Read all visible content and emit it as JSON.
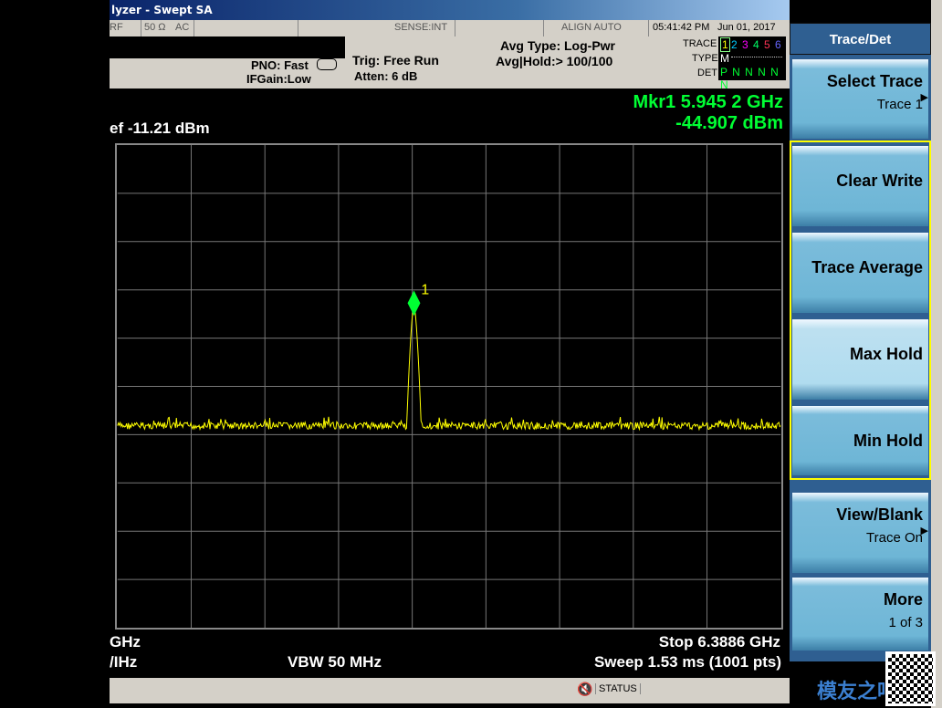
{
  "window": {
    "title": "lyzer - Swept SA"
  },
  "status": {
    "rf": "RF",
    "impedance": "50 Ω",
    "coupling": "AC",
    "sense": "SENSE:INT",
    "align": "ALIGN AUTO",
    "time": "05:41:42 PM",
    "date": "Jun 01, 2017"
  },
  "settings": {
    "pno": "PNO: Fast",
    "ifgain": "IFGain:Low",
    "trig": "Trig: Free Run",
    "atten": "Atten: 6 dB",
    "avg_type": "Avg Type: Log-Pwr",
    "avg_hold": "Avg|Hold:> 100/100"
  },
  "trace_table": {
    "trace_label": "TRACE",
    "type_label": "TYPE",
    "det_label": "DET",
    "traces": [
      "1",
      "2",
      "3",
      "4",
      "5",
      "6"
    ],
    "trace_colors": [
      "#ffff00",
      "#00ccff",
      "#ff00ff",
      "#00ff66",
      "#ff3355",
      "#6666ff"
    ],
    "type": "M",
    "det": "P N N N N N"
  },
  "ref_level": "ef -11.21 dBm",
  "marker": {
    "label": "Mkr1 5.945 2 GHz",
    "value": "-44.907 dBm",
    "number": "1",
    "color": "#00ff33",
    "x_fraction": 0.447,
    "level_fraction": 0.305
  },
  "footer": {
    "center": "GHz",
    "res_bw": "/IHz",
    "vbw": "VBW 50 MHz",
    "stop": "Stop 6.3886 GHz",
    "sweep": "Sweep  1.53 ms (1001 pts)"
  },
  "statusbar": {
    "status": "STATUS"
  },
  "softkeys": {
    "title": "Trace/Det",
    "keys": [
      {
        "main": "Select Trace",
        "sub": "Trace 1",
        "arrow": true
      },
      {
        "main": "Clear Write",
        "sub": ""
      },
      {
        "main": "Trace Average",
        "sub": ""
      },
      {
        "main": "Max Hold",
        "sub": ""
      },
      {
        "main": "Min Hold",
        "sub": ""
      },
      {
        "main": "View/Blank",
        "sub": "Trace On",
        "arrow": true
      },
      {
        "main": "More",
        "sub": "1 of 3"
      }
    ]
  },
  "trace_color": "#ffff00",
  "watermark": "模友之吧"
}
